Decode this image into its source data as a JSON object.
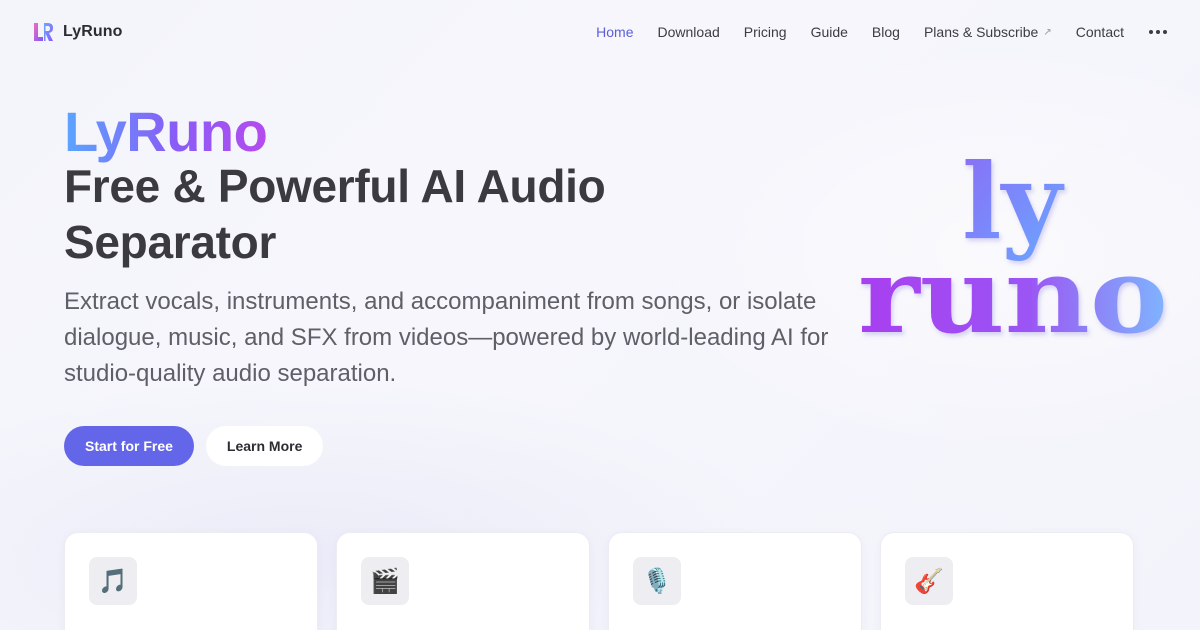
{
  "nav": {
    "brand": "LyRuno",
    "links": [
      {
        "label": "Home",
        "active": true
      },
      {
        "label": "Download"
      },
      {
        "label": "Pricing"
      },
      {
        "label": "Guide"
      },
      {
        "label": "Blog"
      },
      {
        "label": "Plans & Subscribe",
        "external": true
      },
      {
        "label": "Contact"
      }
    ],
    "external_icon": "↗",
    "more_icon": "more-dots-icon"
  },
  "hero": {
    "brand": "LyRuno",
    "title": "Free & Powerful AI Audio Separator",
    "description": "Extract vocals, instruments, and accompaniment from songs, or isolate dialogue, music, and SFX from videos—powered by world-leading AI for studio-quality audio separation.",
    "primary_button": "Start for Free",
    "secondary_button": "Learn More"
  },
  "logo_art": {
    "line1": "ly",
    "line2": "runo"
  },
  "features": [
    {
      "icon": "music-note-icon",
      "glyph": "🎵"
    },
    {
      "icon": "clapper-board-icon",
      "glyph": "🎬"
    },
    {
      "icon": "microphone-icon",
      "glyph": "🎙️"
    },
    {
      "icon": "guitar-icon",
      "glyph": "🎸"
    }
  ],
  "colors": {
    "accent": "#6366e8",
    "active_link": "#5c5fd9",
    "brand_gradient_start": "#5aa5ff",
    "brand_gradient_end": "#b54bf0"
  }
}
